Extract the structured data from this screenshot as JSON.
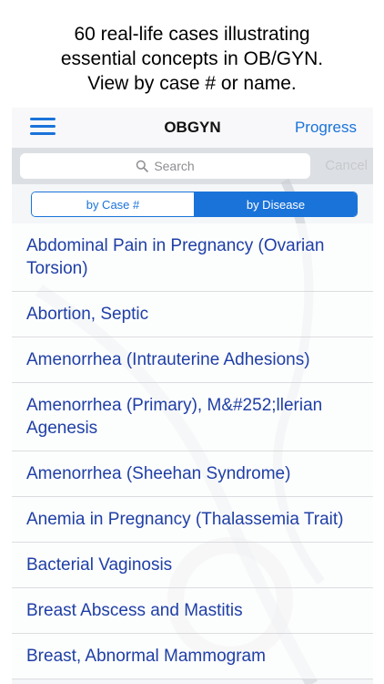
{
  "caption": {
    "line1": "60 real-life cases illustrating",
    "line2": "essential concepts in OB/GYN.",
    "line3": "View by case # or name."
  },
  "navbar": {
    "title": "OBGYN",
    "right_label": "Progress",
    "menu_icon": "hamburger-menu-icon"
  },
  "search": {
    "placeholder": "Search",
    "cancel_label": "Cancel",
    "icon": "search-icon"
  },
  "segment": {
    "options": [
      "by Case #",
      "by Disease"
    ],
    "selected": "by Disease"
  },
  "list": {
    "items": [
      "Abdominal Pain in Pregnancy (Ovarian Torsion)",
      "Abortion, Septic",
      "Amenorrhea (Intrauterine Adhesions)",
      "Amenorrhea (Primary), M&#252;llerian Agenesis",
      "Amenorrhea (Sheehan Syndrome)",
      "Anemia in Pregnancy (Thalassemia Trait)",
      "Bacterial Vaginosis",
      "Breast Abscess and Mastitis",
      "Breast, Abnormal Mammogram"
    ]
  },
  "colors": {
    "accent": "#1a73d9",
    "list_text": "#1f3fa6"
  }
}
